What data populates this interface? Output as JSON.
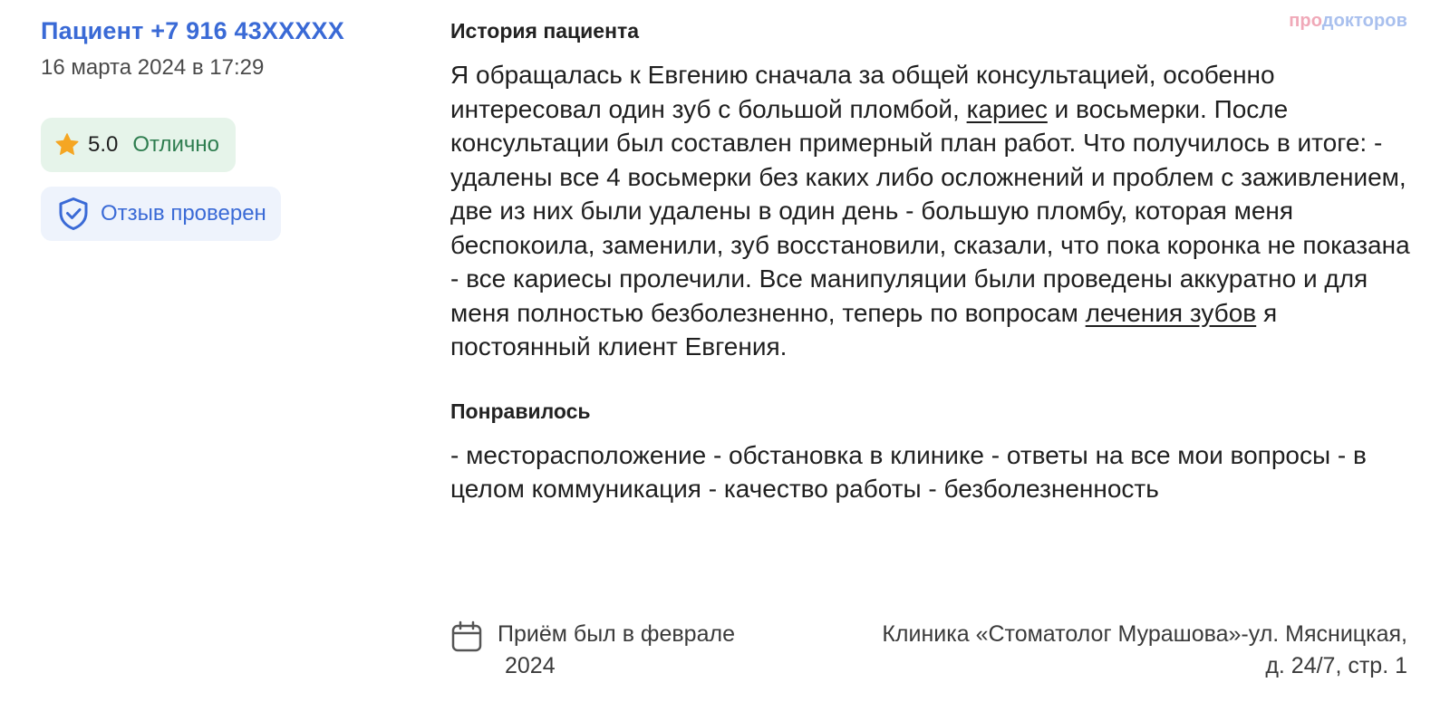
{
  "author": {
    "name": "Пациент +7 916 43XXXXX",
    "date": "16 марта 2024 в 17:29"
  },
  "rating": {
    "value": "5.0",
    "label": "Отлично",
    "star_color": "#f5a623"
  },
  "verified": {
    "label": "Отзыв проверен",
    "icon": "shield-check-icon"
  },
  "logo": {
    "part1": "про",
    "part2": "докторов"
  },
  "history": {
    "title": "История пациента",
    "segments": [
      {
        "text": "Я обращалась к Евгению сначала за общей консультацией, особенно интересовал один зуб с большой пломбой, ",
        "link": false
      },
      {
        "text": "кариес",
        "link": true
      },
      {
        "text": " и восьмерки. После консультации был составлен примерный план работ. Что получилось в итоге: - удалены все 4 восьмерки без каких либо осложнений и проблем с заживлением, две из них были удалены в один день - большую пломбу, которая меня беспокоила, заменили, зуб восстановили, сказали, что пока коронка не показана - все кариесы пролечили. Все манипуляции были проведены аккуратно и для меня полностью безболезненно, теперь по вопросам ",
        "link": false
      },
      {
        "text": "лечения зубов",
        "link": true
      },
      {
        "text": " я постоянный клиент Евгения.",
        "link": false
      }
    ]
  },
  "liked": {
    "title": "Понравилось",
    "text": "- месторасположение - обстановка в клинике - ответы на все мои вопросы - в целом коммуникация - качество работы - безболезненность"
  },
  "footer": {
    "visit_line1": "Приём был в феврале",
    "visit_line2": "2024",
    "clinic_line1": "Клиника «Стоматолог Мурашова»-ул. Мясницкая,",
    "clinic_line2": "д. 24/7, стр. 1"
  }
}
